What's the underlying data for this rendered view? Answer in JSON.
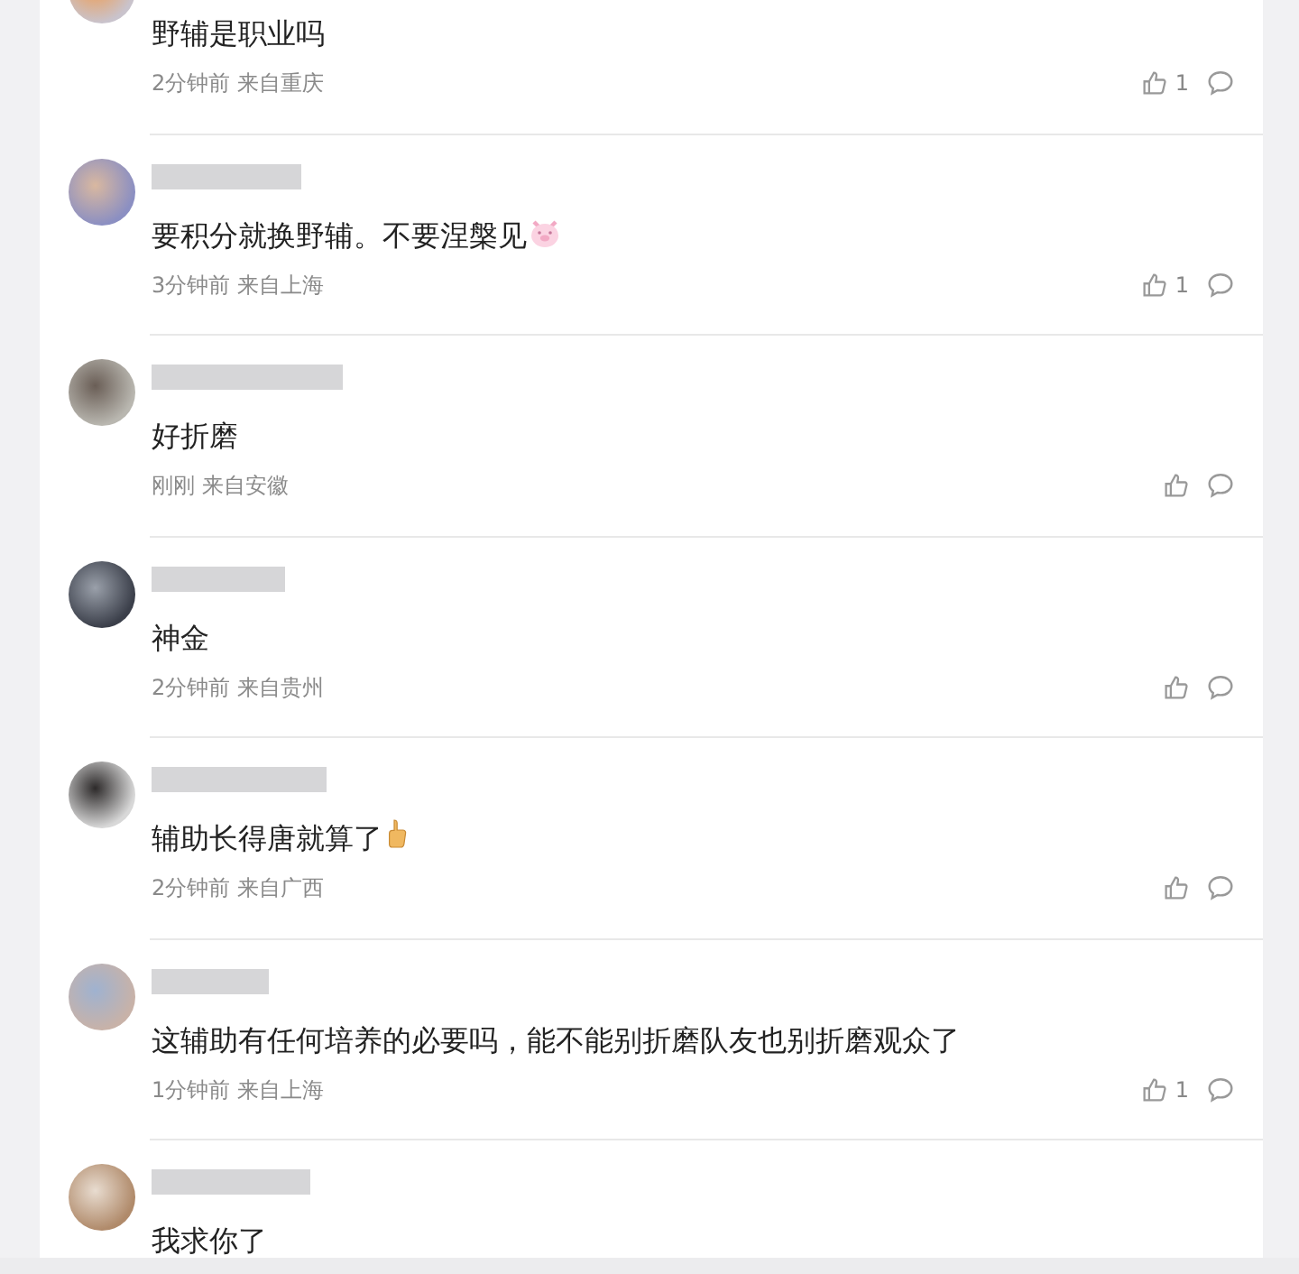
{
  "comments": [
    {
      "kind": "plain",
      "text": "野辅是职业吗",
      "time": "2分钟前",
      "location": "来自重庆",
      "likes": "1"
    },
    {
      "kind": "pig_emoji",
      "text": "要积分就换野辅。不要涅槃见",
      "time": "3分钟前",
      "location": "来自上海",
      "likes": "1"
    },
    {
      "kind": "plain",
      "text": "好折磨",
      "time": "刚刚",
      "location": "来自安徽"
    },
    {
      "kind": "plain",
      "text": "神金",
      "time": "2分钟前",
      "location": "来自贵州"
    },
    {
      "kind": "thumb_emoji",
      "text": "辅助长得唐就算了",
      "time": "2分钟前",
      "location": "来自广西"
    },
    {
      "kind": "plain",
      "text": "这辅助有任何培养的必要吗，能不能别折磨队友也别折磨观众了",
      "time": "1分钟前",
      "location": "来自上海",
      "likes": "1"
    },
    {
      "kind": "plain",
      "text": "我求你了"
    }
  ]
}
